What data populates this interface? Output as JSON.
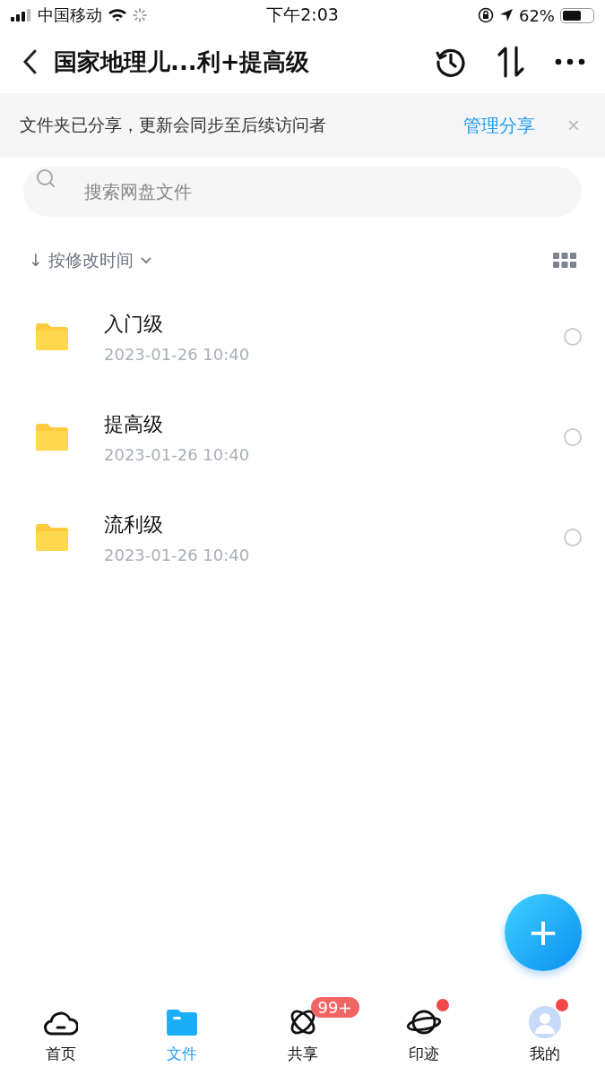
{
  "status_bar": {
    "carrier": "中国移动",
    "time": "下午2:03",
    "battery": "62%"
  },
  "nav": {
    "title": "国家地理儿...利+提高级"
  },
  "banner": {
    "text": "文件夹已分享，更新会同步至后续访问者",
    "action": "管理分享",
    "close": "×"
  },
  "search": {
    "placeholder": "搜索网盘文件"
  },
  "sort": {
    "arrow": "↓",
    "label": "按修改时间"
  },
  "files": [
    {
      "name": "入门级",
      "date": "2023-01-26 10:40",
      "selected": false
    },
    {
      "name": "提高级",
      "date": "2023-01-26 10:40",
      "selected": false
    },
    {
      "name": "流利级",
      "date": "2023-01-26 10:40",
      "selected": false
    }
  ],
  "fab": "+",
  "tabs": [
    {
      "label": "首页",
      "kind": "cloud",
      "selected": false
    },
    {
      "label": "文件",
      "kind": "folder",
      "selected": true
    },
    {
      "label": "共享",
      "kind": "orbit",
      "selected": false,
      "badge": "99+"
    },
    {
      "label": "印迹",
      "kind": "planet",
      "selected": false,
      "dot": true
    },
    {
      "label": "我的",
      "kind": "avatar",
      "selected": false,
      "dot": true
    }
  ]
}
